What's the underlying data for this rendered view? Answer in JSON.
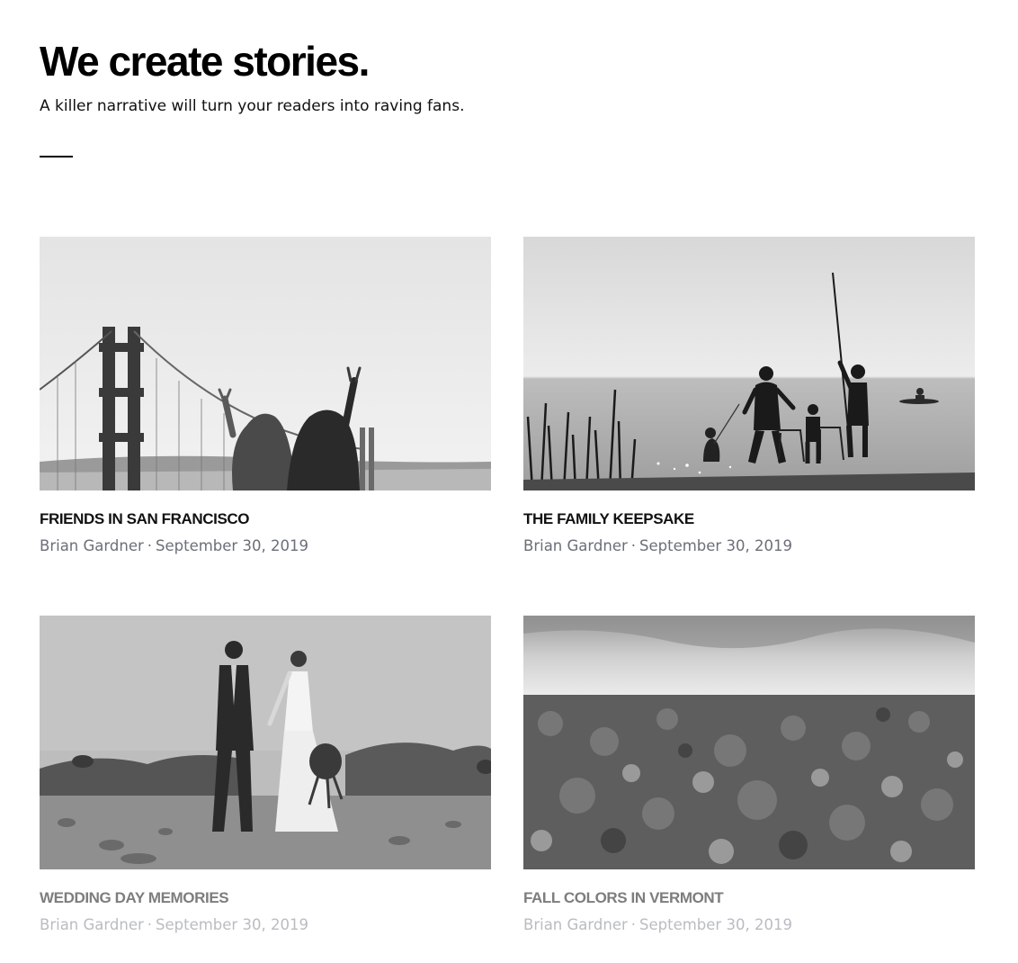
{
  "header": {
    "headline": "We create stories.",
    "tagline": "A killer narrative will turn your readers into raving fans."
  },
  "posts": [
    {
      "title": "FRIENDS IN SAN FRANCISCO",
      "author": "Brian Gardner",
      "separator": "·",
      "date": "September 30, 2019",
      "image": "golden-gate-bridge-friends-photo"
    },
    {
      "title": "THE FAMILY KEEPSAKE",
      "author": "Brian Gardner",
      "separator": "·",
      "date": "September 30, 2019",
      "image": "family-silhouette-lake-photo"
    },
    {
      "title": "WEDDING DAY MEMORIES",
      "author": "Brian Gardner",
      "separator": "·",
      "date": "September 30, 2019",
      "image": "wedding-couple-shore-photo"
    },
    {
      "title": "FALL COLORS IN VERMONT",
      "author": "Brian Gardner",
      "separator": "·",
      "date": "September 30, 2019",
      "image": "vermont-forest-aerial-photo"
    }
  ],
  "colors": {
    "text": "#111111",
    "meta": "#6b6f78",
    "faded_title": "#7d7d7d",
    "faded_meta": "#b9bcc2"
  }
}
